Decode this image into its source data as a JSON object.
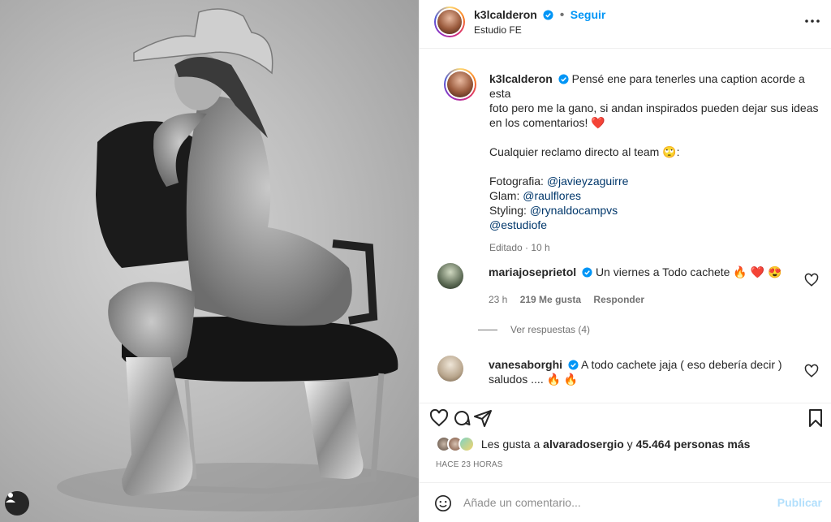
{
  "post": {
    "author": "k3lcalderon",
    "follow_label": "Seguir",
    "location": "Estudio FE"
  },
  "caption": {
    "line1": "Pensé ene para tenerles una caption acorde a esta",
    "line2": "foto pero me la gano, si andan inspirados pueden dejar sus ideas",
    "line3": "en los comentarios! ❤️",
    "line4": "Cualquier reclamo directo al team 🙄:",
    "photo_label": "Fotografia: ",
    "photo_handle": "@javieyzaguirre",
    "glam_label": "Glam: ",
    "glam_handle": "@raulflores",
    "styling_label": "Styling: ",
    "styling_handle": "@rynaldocampvs",
    "studio_handle": "@estudiofe",
    "edited": "Editado · 10 h"
  },
  "comments": [
    {
      "user": "mariajoseprietol",
      "text": "Un viernes a Todo cachete 🔥 ❤️ 😍",
      "time": "23 h",
      "likes": "219 Me gusta",
      "reply_label": "Responder",
      "view_replies": "Ver respuestas (4)"
    },
    {
      "user": "vanesaborghi",
      "text_line1": "A todo cachete jaja ( eso debería decir )",
      "text_line2": "saludos .... 🔥 🔥"
    }
  ],
  "likes": {
    "prefix": "Les gusta a ",
    "user": "alvaradosergio",
    "middle": " y ",
    "count": "45.464 personas más"
  },
  "timestamp": "Hace 23 horas",
  "composer": {
    "placeholder": "Añade un comentario...",
    "post_label": "Publicar"
  },
  "icons": {
    "more": "more-horizontal-icon",
    "verified": "verified-badge-icon",
    "like": "heart-icon",
    "comment": "comment-icon",
    "share": "send-icon",
    "save": "bookmark-icon",
    "emoji": "emoji-icon",
    "tags": "user-tag-icon"
  },
  "colors": {
    "accent": "#0095f6",
    "verified": "#0095f6",
    "link": "#00376b",
    "muted": "#737373"
  }
}
